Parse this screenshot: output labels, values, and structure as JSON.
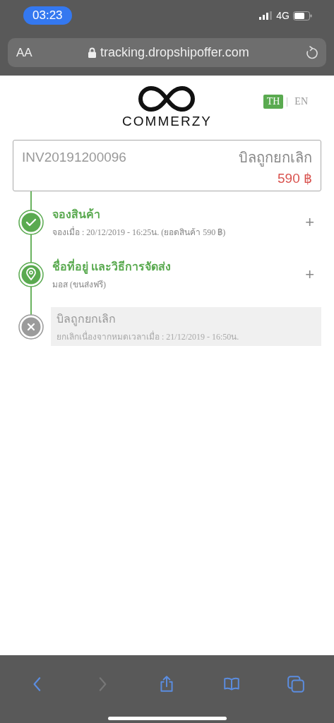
{
  "status_bar": {
    "time": "03:23",
    "network": "4G"
  },
  "address_bar": {
    "text_size": "AA",
    "url": "tracking.dropshipoffer.com"
  },
  "logo": {
    "name": "COMMERZY"
  },
  "languages": [
    {
      "label": "TH",
      "selected": true
    },
    {
      "label": "EN",
      "selected": false
    }
  ],
  "invoice": {
    "number": "INV20191200096",
    "status": "บิลถูกยกเลิก",
    "total": "590 ฿"
  },
  "steps": [
    {
      "kind": "done",
      "title": "จองสินค้า",
      "detail": "จองเมื่อ : 20/12/2019 - 16:25น. (ยอดสินค้า 590 ฿)",
      "expand": "+"
    },
    {
      "kind": "location",
      "title": "ชื่อที่อยู่ และวิธีการจัดส่ง",
      "detail": "มอส (ขนส่งฟรี)",
      "expand": "+"
    },
    {
      "kind": "cancelled",
      "title": "บิลถูกยกเลิก",
      "detail": "ยกเลิกเนื่องจากหมดเวลาเมื่อ : 21/12/2019 - 16:50น."
    }
  ],
  "toolbar": [
    {
      "kind": "back",
      "disabled": false
    },
    {
      "kind": "forward",
      "disabled": true
    },
    {
      "kind": "share",
      "disabled": false
    },
    {
      "kind": "bookmarks",
      "disabled": false
    },
    {
      "kind": "tabs",
      "disabled": false
    }
  ]
}
